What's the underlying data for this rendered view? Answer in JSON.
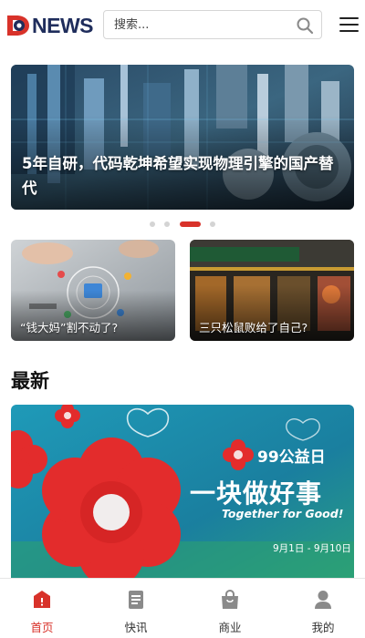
{
  "header": {
    "logo_text": "NEWS",
    "logo_mark": "D",
    "search_placeholder": "搜索...",
    "menu_icon": "hamburger-menu-icon"
  },
  "hero": {
    "title": "5年自研，代码乾坤希望实现物理引擎的国产替代",
    "carousel_count": 4,
    "carousel_active_index": 2
  },
  "cards": [
    {
      "title": "“钱大妈”割不动了?"
    },
    {
      "title": "三只松鼠败给了自己?"
    }
  ],
  "latest": {
    "heading": "最新",
    "featured": {
      "badge": "99公益日",
      "headline": "一块做好事",
      "english": "Together for Good!",
      "date_range": "9月1日 - 9月10日"
    }
  },
  "tabbar": {
    "items": [
      {
        "label": "首页",
        "icon": "home-icon",
        "active": true
      },
      {
        "label": "快讯",
        "icon": "news-icon",
        "active": false
      },
      {
        "label": "商业",
        "icon": "bag-icon",
        "active": false
      },
      {
        "label": "我的",
        "icon": "user-icon",
        "active": false
      }
    ]
  },
  "colors": {
    "accent": "#d8322a",
    "brand_navy": "#1f2d5c",
    "featured_bg": "#1d8fb0"
  }
}
